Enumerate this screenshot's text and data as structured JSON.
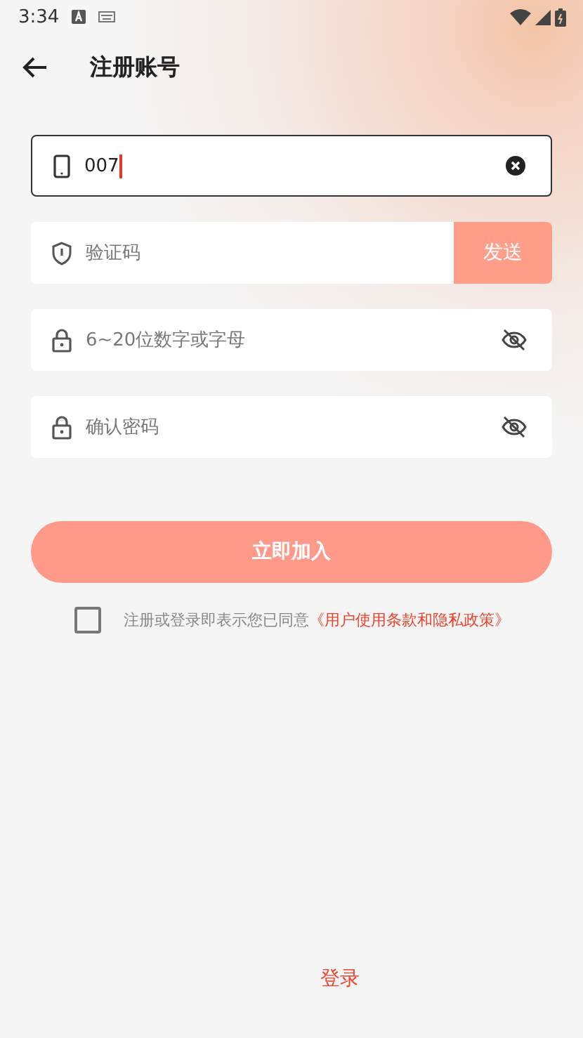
{
  "status_bar": {
    "time": "3:34"
  },
  "header": {
    "title": "注册账号"
  },
  "fields": [
    {
      "kind": "phone",
      "value": "007",
      "focused": true
    },
    {
      "kind": "code",
      "placeholder": "验证码",
      "button": "发送"
    },
    {
      "kind": "password",
      "placeholder": "6~20位数字或字母"
    },
    {
      "kind": "password",
      "placeholder": "确认密码"
    }
  ],
  "submit_button": "立即加入",
  "agreement": {
    "checked": false,
    "text": "注册或登录即表示您已同意",
    "link": "《用户使用条款和隐私政策》"
  },
  "footer": {
    "link": "登录"
  }
}
